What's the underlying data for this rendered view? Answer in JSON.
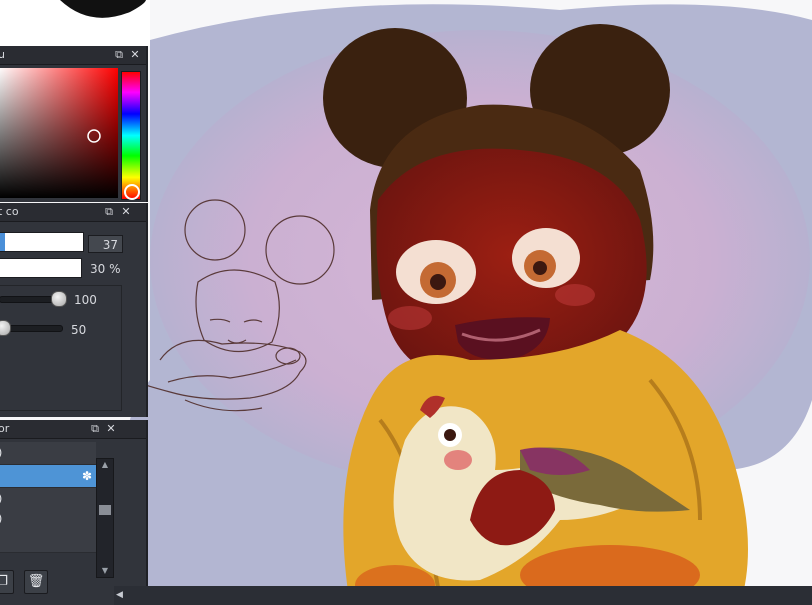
{
  "panels": {
    "color": {
      "title": "u"
    },
    "brush": {
      "title": "t co",
      "size_value": "37",
      "opacity_value": "30 %",
      "size_fraction": 0.95,
      "opacity_fraction": 0.92,
      "min_size_value": "100",
      "min_opacity_value": "50"
    },
    "layer": {
      "title": "or",
      "rows": [
        {
          "name": ")"
        },
        {
          "name": ""
        },
        {
          "name": ")"
        },
        {
          "name": ")"
        },
        {
          "name": ""
        }
      ],
      "active_row": 1
    }
  },
  "icons": {
    "popout": "popout-icon",
    "close": "close-icon",
    "gear": "gear-icon",
    "duplicate": "duplicate-layer-icon",
    "trash": "trash-icon"
  },
  "colors": {
    "selected": "#8a1c14",
    "accent": "#4e94d6",
    "panel_bg": "#31343b"
  }
}
